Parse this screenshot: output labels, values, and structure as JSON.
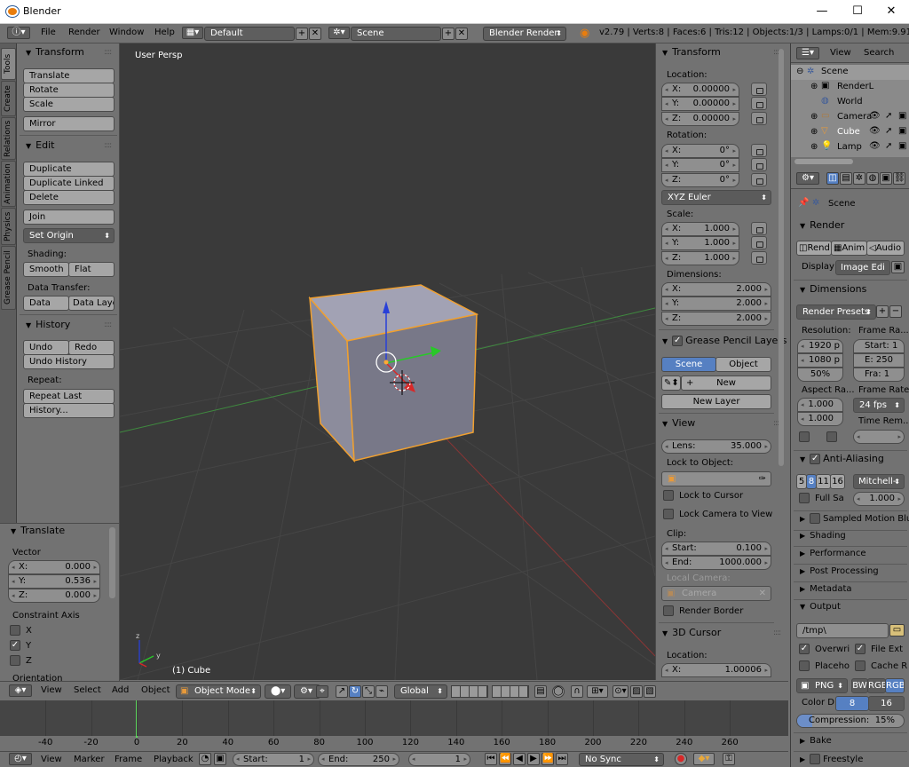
{
  "window": {
    "title": "Blender",
    "minimize": "—",
    "maximize": "☐",
    "close": "✕"
  },
  "info_header": {
    "menus": [
      "File",
      "Render",
      "Window",
      "Help"
    ],
    "screen_layout": "Default",
    "scene": "Scene",
    "engine": "Blender Render",
    "stats": "v2.79 | Verts:8 | Faces:6 | Tris:12 | Objects:1/3 | Lamps:0/1 | Mem:9.91M | Cube"
  },
  "tool_tabs": [
    "Tools",
    "Create",
    "Relations",
    "Animation",
    "Physics",
    "Grease Pencil"
  ],
  "tool_shelf": {
    "transform": {
      "header": "Transform",
      "buttons": [
        "Translate",
        "Rotate",
        "Scale",
        "Mirror"
      ]
    },
    "edit": {
      "header": "Edit",
      "buttons": [
        "Duplicate",
        "Duplicate Linked",
        "Delete",
        "Join"
      ],
      "set_origin": "Set Origin",
      "shading_label": "Shading:",
      "smooth": "Smooth",
      "flat": "Flat",
      "data_transfer_label": "Data Transfer:",
      "data": "Data",
      "data_layout": "Data Layo"
    },
    "history": {
      "header": "History",
      "undo": "Undo",
      "redo": "Redo",
      "undo_history": "Undo History",
      "repeat_label": "Repeat:",
      "repeat_last": "Repeat Last",
      "history_btn": "History..."
    }
  },
  "operator_panel": {
    "header": "Translate",
    "vector_label": "Vector",
    "x": {
      "k": "X:",
      "v": "0.000"
    },
    "y": {
      "k": "Y:",
      "v": "0.536"
    },
    "z": {
      "k": "Z:",
      "v": "0.000"
    },
    "constraint_label": "Constraint Axis",
    "cx": "X",
    "cy": "Y",
    "cz": "Z",
    "orientation": "Orientation"
  },
  "viewport": {
    "label": "User Persp",
    "object_label": "(1) Cube"
  },
  "n_panel": {
    "transform_header": "Transform",
    "location_label": "Location:",
    "loc": [
      {
        "k": "X:",
        "v": "0.00000"
      },
      {
        "k": "Y:",
        "v": "0.00000"
      },
      {
        "k": "Z:",
        "v": "0.00000"
      }
    ],
    "rotation_label": "Rotation:",
    "rot": [
      {
        "k": "X:",
        "v": "0°"
      },
      {
        "k": "Y:",
        "v": "0°"
      },
      {
        "k": "Z:",
        "v": "0°"
      }
    ],
    "rotation_mode": "XYZ Euler",
    "scale_label": "Scale:",
    "scale": [
      {
        "k": "X:",
        "v": "1.000"
      },
      {
        "k": "Y:",
        "v": "1.000"
      },
      {
        "k": "Z:",
        "v": "1.000"
      }
    ],
    "dimensions_label": "Dimensions:",
    "dims": [
      {
        "k": "X:",
        "v": "2.000"
      },
      {
        "k": "Y:",
        "v": "2.000"
      },
      {
        "k": "Z:",
        "v": "2.000"
      }
    ],
    "gp_header": "Grease Pencil Layers",
    "gp_scene": "Scene",
    "gp_object": "Object",
    "gp_new": "New",
    "gp_new_layer": "New Layer",
    "view_header": "View",
    "lens": {
      "k": "Lens:",
      "v": "35.000"
    },
    "lock_to_object": "Lock to Object:",
    "lock_to_cursor": "Lock to Cursor",
    "lock_camera": "Lock Camera to View",
    "clip_label": "Clip:",
    "clip_start": {
      "k": "Start:",
      "v": "0.100"
    },
    "clip_end": {
      "k": "End:",
      "v": "1000.000"
    },
    "local_camera_label": "Local Camera:",
    "camera": "Camera",
    "render_border": "Render Border",
    "cursor_header": "3D Cursor",
    "cursor_location": "Location:",
    "cursor_x": {
      "k": "X:",
      "v": "1.00006"
    }
  },
  "outliner": {
    "menus": [
      "View",
      "Search"
    ],
    "items": [
      "Scene",
      "RenderL",
      "World",
      "Camera",
      "Cube",
      "Lamp"
    ]
  },
  "properties": {
    "scene": "Scene",
    "render_header": "Render",
    "render_btn": "Rend",
    "anim_btn": "Anim",
    "audio_btn": "Audio",
    "display_label": "Display",
    "display_value": "Image Edi",
    "dimensions_header": "Dimensions",
    "render_presets": "Render Presets",
    "resolution_label": "Resolution:",
    "frame_range_label": "Frame Ra...",
    "res_x": "1920 p",
    "res_y": "1080 p",
    "res_pct": "50%",
    "start": "Start: 1",
    "end": "E:  250",
    "frame": "Fra:   1",
    "aspect_label": "Aspect Ra...",
    "framerate_label": "Frame Rate:",
    "aspect_x": "1.000",
    "aspect_y": "1.000",
    "fps": "24 fps",
    "time_remap": "Time Rem...",
    "aa_header": "Anti-Aliasing",
    "aa_samples": [
      "5",
      "8",
      "11",
      "16"
    ],
    "aa_filter": "Mitchell-",
    "full_sample": "Full Sa",
    "aa_size": "1.000",
    "sampled_motion": "Sampled Motion Blur",
    "shading": "Shading",
    "performance": "Performance",
    "post_processing": "Post Processing",
    "metadata": "Metadata",
    "output_header": "Output",
    "output_path": "/tmp\\",
    "overwrite": "Overwri",
    "file_ext": "File Ext",
    "placeholders": "Placeho",
    "cache": "Cache R",
    "format": "PNG",
    "bw": "BW",
    "rgb": "RGB",
    "rgba": "RGB",
    "color_depth_label": "Color D",
    "depth8": "8",
    "depth16": "16",
    "compression": "Compression:",
    "compression_val": "15%",
    "bake": "Bake",
    "freestyle": "Freestyle"
  },
  "v3d_header": {
    "menus": [
      "View",
      "Select",
      "Add",
      "Object"
    ],
    "mode": "Object Mode",
    "orientation": "Global"
  },
  "timeline": {
    "ticks": [
      "-40",
      "-20",
      "0",
      "20",
      "40",
      "60",
      "80",
      "100",
      "120",
      "140",
      "160",
      "180",
      "200",
      "220",
      "240",
      "260"
    ]
  },
  "tl_header": {
    "menus": [
      "View",
      "Marker",
      "Frame",
      "Playback"
    ],
    "start": {
      "k": "Start:",
      "v": "1"
    },
    "end": {
      "k": "End:",
      "v": "250"
    },
    "current": "1",
    "sync": "No Sync"
  }
}
